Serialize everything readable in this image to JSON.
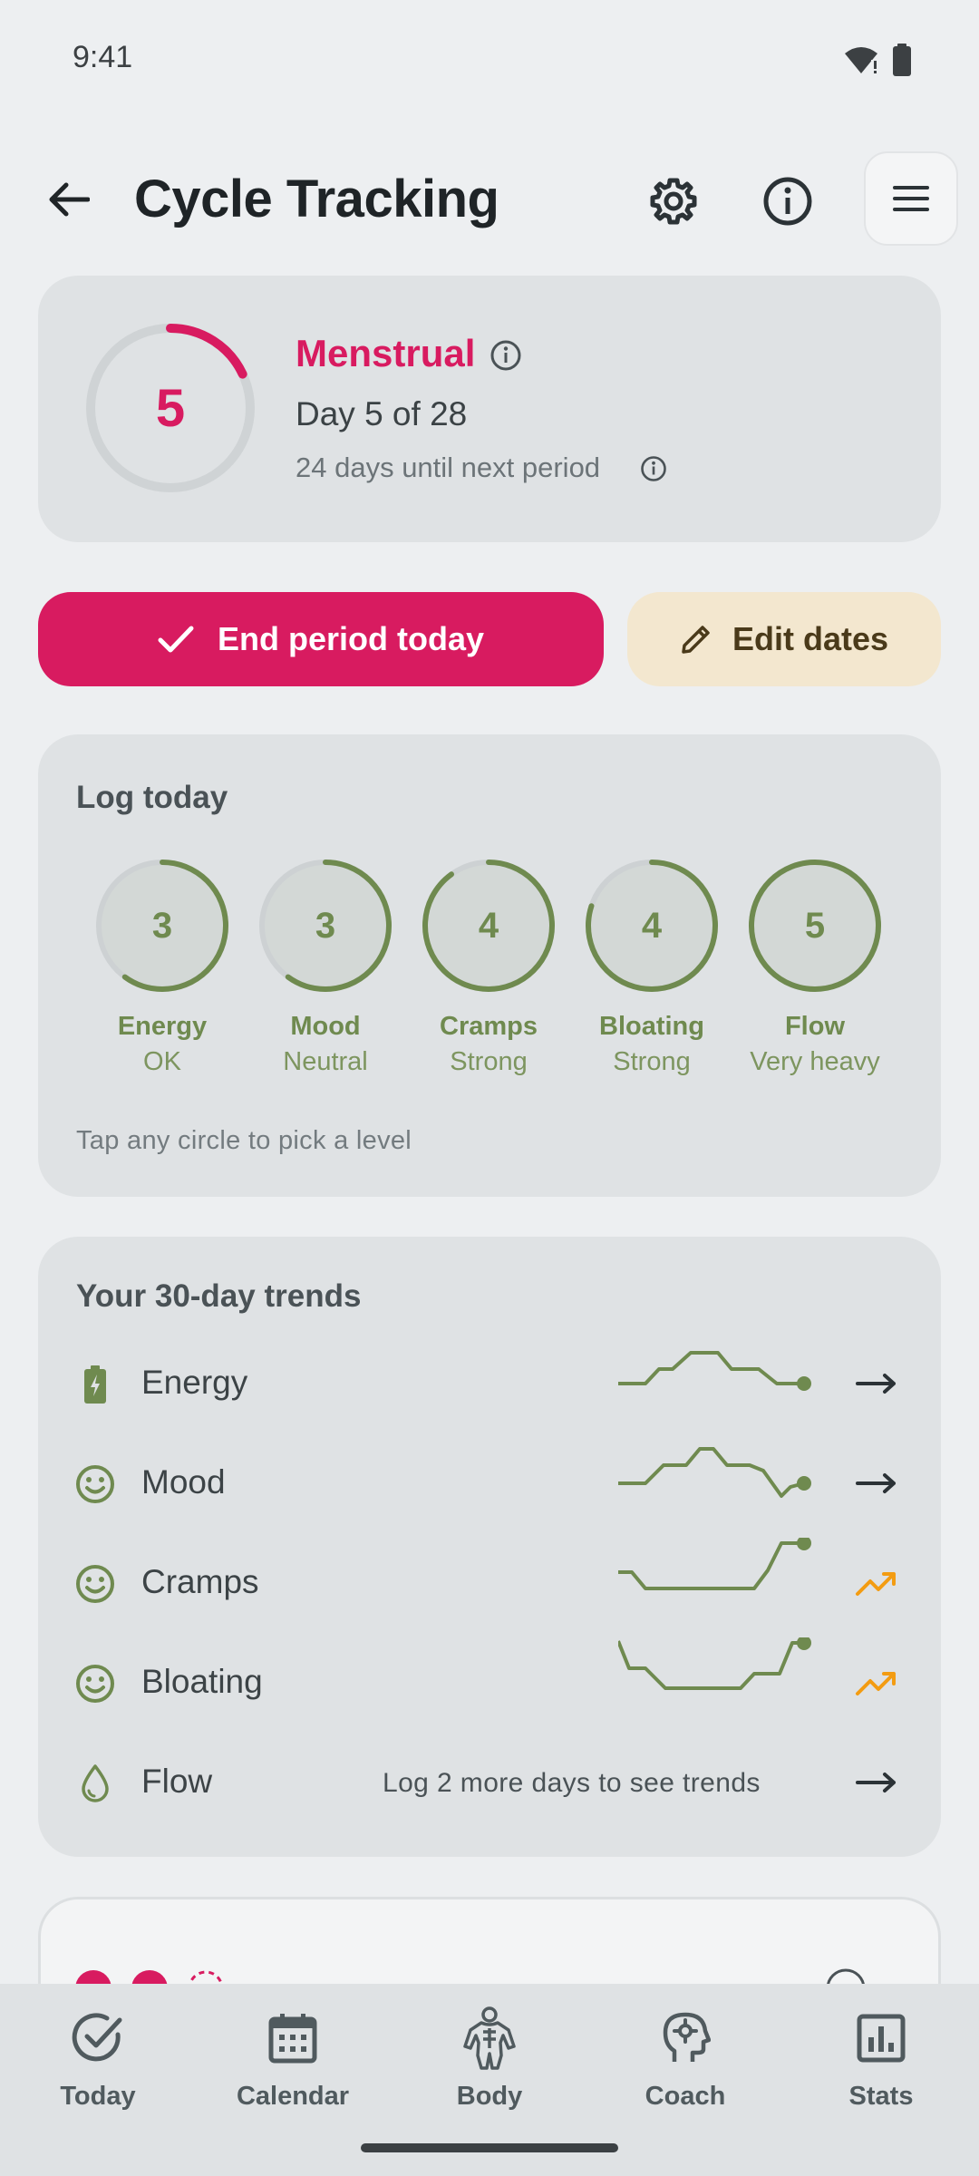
{
  "status": {
    "time": "9:41"
  },
  "header": {
    "title": "Cycle Tracking"
  },
  "cycle": {
    "day_number": "5",
    "progress_fraction": 0.18,
    "phase": "Menstrual",
    "day_text": "Day 5 of 28",
    "next_period_text": "24 days until next period"
  },
  "actions": {
    "end_period_label": "End period today",
    "edit_dates_label": "Edit dates"
  },
  "log": {
    "title": "Log today",
    "items": [
      {
        "value": "3",
        "label": "Energy",
        "level": "OK",
        "fraction": 0.6
      },
      {
        "value": "3",
        "label": "Mood",
        "level": "Neutral",
        "fraction": 0.6
      },
      {
        "value": "4",
        "label": "Cramps",
        "level": "Strong",
        "fraction": 0.9
      },
      {
        "value": "4",
        "label": "Bloating",
        "level": "Strong",
        "fraction": 0.8
      },
      {
        "value": "5",
        "label": "Flow",
        "level": "Very heavy",
        "fraction": 1.0
      }
    ],
    "hint": "Tap any circle to pick a level"
  },
  "trends": {
    "title": "Your 30-day trends",
    "rows": [
      {
        "name": "Energy",
        "icon": "battery-icon",
        "trend": "flat"
      },
      {
        "name": "Mood",
        "icon": "smiley-icon",
        "trend": "flat"
      },
      {
        "name": "Cramps",
        "icon": "smiley-icon",
        "trend": "up"
      },
      {
        "name": "Bloating",
        "icon": "smiley-icon",
        "trend": "up"
      },
      {
        "name": "Flow",
        "icon": "droplet-icon",
        "trend": "flat",
        "message": "Log 2 more days to see trends"
      }
    ]
  },
  "nav": {
    "items": [
      {
        "label": "Today",
        "icon": "check-circle-icon"
      },
      {
        "label": "Calendar",
        "icon": "calendar-icon"
      },
      {
        "label": "Body",
        "icon": "body-icon"
      },
      {
        "label": "Coach",
        "icon": "coach-icon"
      },
      {
        "label": "Stats",
        "icon": "stats-icon"
      }
    ]
  },
  "colors": {
    "accent": "#d81b60",
    "olive": "#6f8a4f",
    "trend_up": "#f39c12"
  }
}
